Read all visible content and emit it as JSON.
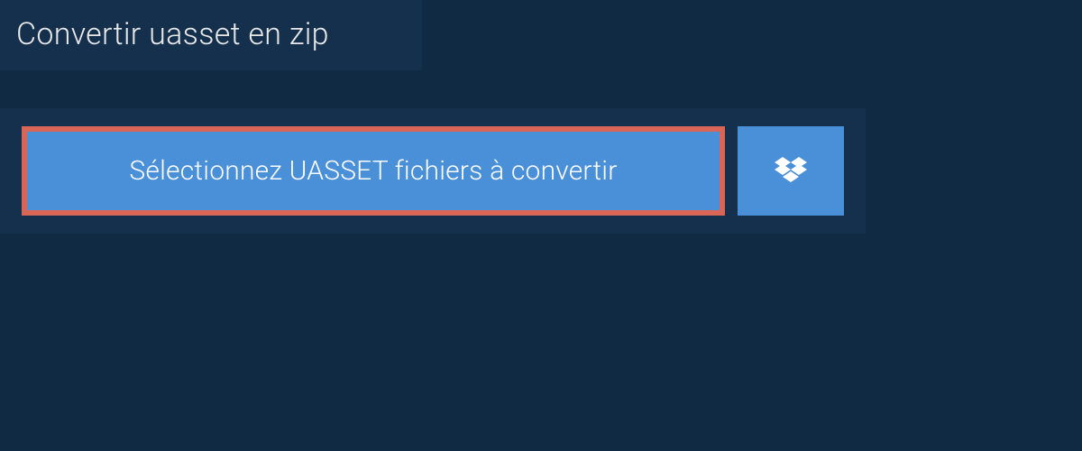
{
  "tab": {
    "label": "Convertir uasset en zip"
  },
  "panel": {
    "select_button_label": "Sélectionnez UASSET fichiers à convertir"
  },
  "colors": {
    "background": "#0f2a42",
    "panel": "#14304d",
    "button": "#4a90d9",
    "highlight_border": "#d86556",
    "text_light": "#e8e8e8",
    "text_white": "#ffffff"
  }
}
